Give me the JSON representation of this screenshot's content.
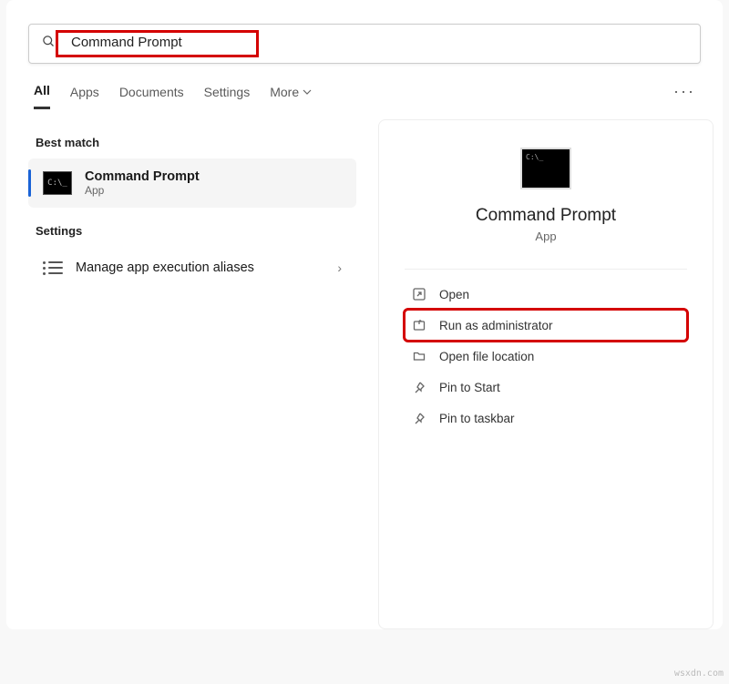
{
  "search": {
    "value": "Command Prompt"
  },
  "tabs": {
    "all": "All",
    "apps": "Apps",
    "documents": "Documents",
    "settings": "Settings",
    "more": "More"
  },
  "sections": {
    "best_match": "Best match",
    "settings": "Settings"
  },
  "best_result": {
    "title": "Command Prompt",
    "subtitle": "App"
  },
  "settings_result": {
    "title": "Manage app execution aliases"
  },
  "preview": {
    "title": "Command Prompt",
    "subtitle": "App"
  },
  "actions": {
    "open": "Open",
    "run_admin": "Run as administrator",
    "open_location": "Open file location",
    "pin_start": "Pin to Start",
    "pin_taskbar": "Pin to taskbar"
  },
  "watermark": "wsxdn.com"
}
